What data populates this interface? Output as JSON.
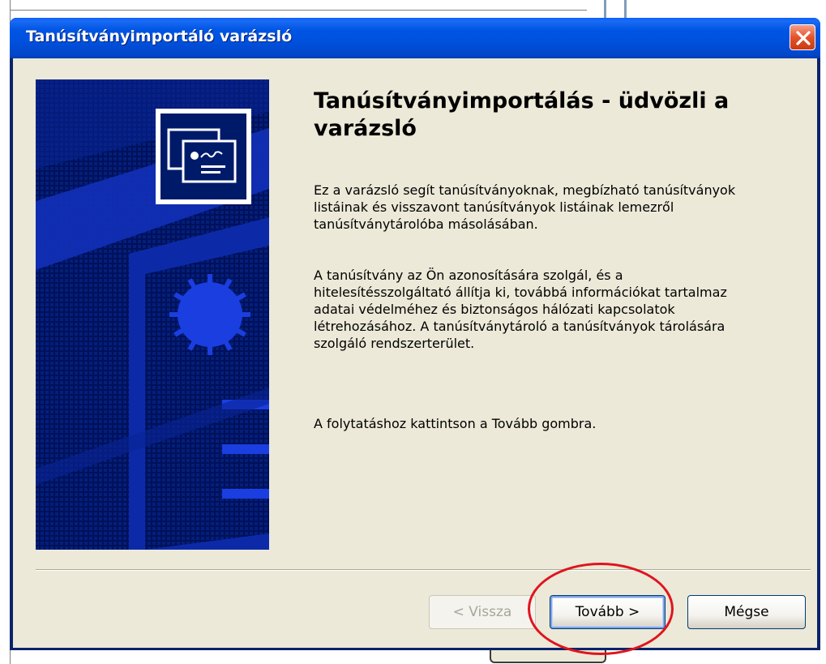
{
  "window": {
    "title": "Tanúsítványimportáló varázsló"
  },
  "wizard": {
    "heading": "Tanúsítványimportálás - üdvözli a varázsló",
    "paragraph1": "Ez a varázsló segít tanúsítványoknak, megbízható tanúsítványok listáinak és visszavont tanúsítványok listáinak lemezről tanúsítványtárolóba másolásában.",
    "paragraph2": "A tanúsítvány az Ön azonosítására szolgál, és a hitelesítésszolgáltató állítja ki, továbbá információkat tartalmaz adatai védelméhez és biztonságos hálózati kapcsolatok létrehozásához. A tanúsítványtároló a tanúsítványok tárolására szolgáló rendszerterület.",
    "paragraph3": "A folytatáshoz kattintson a Tovább gombra."
  },
  "buttons": {
    "back": "< Vissza",
    "next": "Tovább >",
    "cancel": "Mégse"
  },
  "icons": {
    "banner_icon": "certificate-icon",
    "close": "close-icon"
  },
  "colors": {
    "titlebar": "#0055e5",
    "banner": "#001a6a",
    "highlight": "#e0141e"
  }
}
